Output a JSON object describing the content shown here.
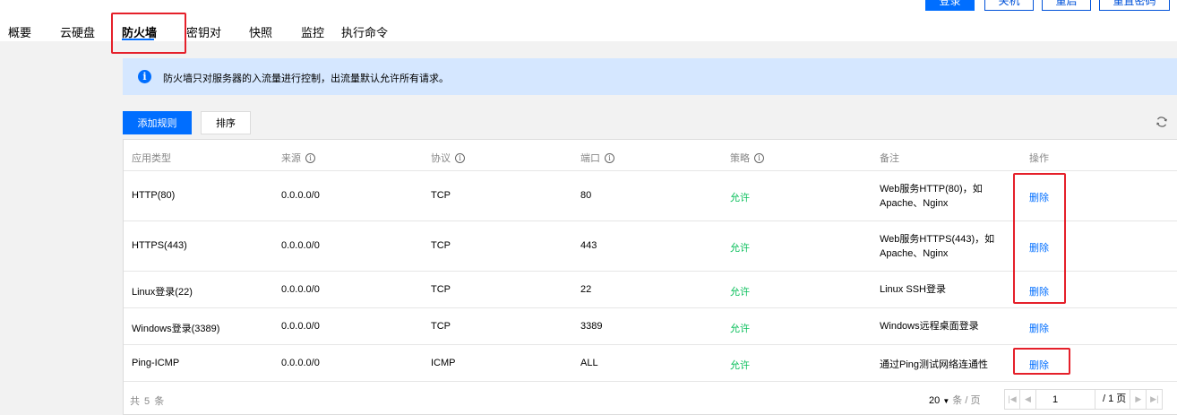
{
  "nav": {
    "tabs": [
      "概要",
      "云硬盘",
      "防火墙",
      "密钥对",
      "快照",
      "监控",
      "执行命令"
    ],
    "active": "防火墙"
  },
  "top_actions": [
    "登录",
    "关机",
    "重启",
    "重置密码"
  ],
  "notice": {
    "text": "防火墙只对服务器的入流量进行控制，出流量默认允许所有请求。"
  },
  "toolbar": {
    "add_rule": "添加规则",
    "sort": "排序"
  },
  "table": {
    "columns": [
      "应用类型",
      "来源",
      "协议",
      "端口",
      "策略",
      "备注",
      "操作"
    ],
    "rows": [
      {
        "app": "HTTP(80)",
        "source": "0.0.0.0/0",
        "protocol": "TCP",
        "port": "80",
        "policy": "允许",
        "note": "Web服务HTTP(80)，如 Apache、Nginx",
        "action": "删除"
      },
      {
        "app": "HTTPS(443)",
        "source": "0.0.0.0/0",
        "protocol": "TCP",
        "port": "443",
        "policy": "允许",
        "note": "Web服务HTTPS(443)，如 Apache、Nginx",
        "action": "删除"
      },
      {
        "app": "Linux登录(22)",
        "source": "0.0.0.0/0",
        "protocol": "TCP",
        "port": "22",
        "policy": "允许",
        "note": "Linux SSH登录",
        "action": "删除"
      },
      {
        "app": "Windows登录(3389)",
        "source": "0.0.0.0/0",
        "protocol": "TCP",
        "port": "3389",
        "policy": "允许",
        "note": "Windows远程桌面登录",
        "action": "删除"
      },
      {
        "app": "Ping-ICMP",
        "source": "0.0.0.0/0",
        "protocol": "ICMP",
        "port": "ALL",
        "policy": "允许",
        "note": "通过Ping测试网络连通性",
        "action": "删除"
      }
    ]
  },
  "footer": {
    "total": "共 5 条",
    "page_size": "20",
    "page_size_unit": "条 / 页",
    "current_page": "1",
    "total_pages": "/ 1 页"
  },
  "colors": {
    "accent": "#006eff",
    "allow": "#0abf5b",
    "highlight": "#e5202a"
  }
}
